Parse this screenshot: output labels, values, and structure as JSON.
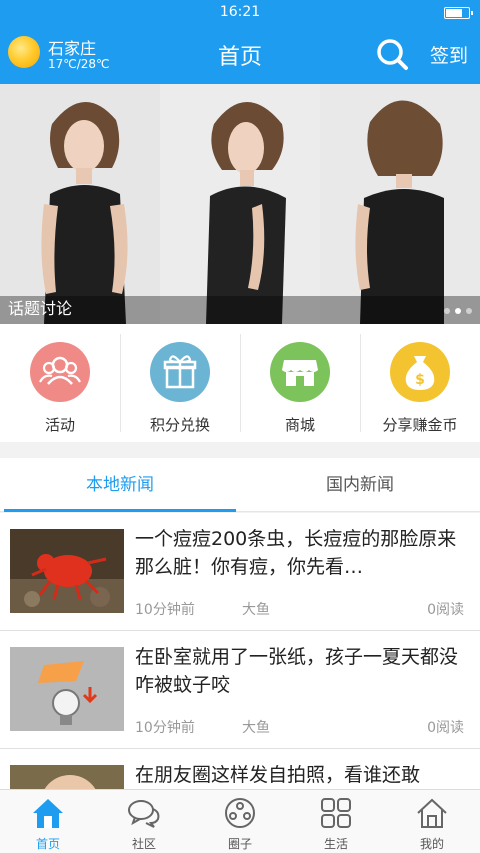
{
  "status_bar": {
    "time": "16:21",
    "battery_level": 0.8
  },
  "header": {
    "city": "石家庄",
    "temperature": "17℃/28℃",
    "title": "首页",
    "signin_label": "签到",
    "weather_icon": "sun-icon",
    "search_icon": "search-icon"
  },
  "banner": {
    "caption": "话题讨论",
    "slide_count": 3,
    "active_slide": 2
  },
  "quick_entries": [
    {
      "label": "活动",
      "icon": "people-icon",
      "color": "#f08a86"
    },
    {
      "label": "积分兑换",
      "icon": "gift-icon",
      "color": "#6cb4d4"
    },
    {
      "label": "商城",
      "icon": "store-icon",
      "color": "#7cc35c"
    },
    {
      "label": "分享赚金币",
      "icon": "money-bag-icon",
      "color": "#f4c430"
    }
  ],
  "tabs": [
    {
      "label": "本地新闻",
      "active": true
    },
    {
      "label": "国内新闻",
      "active": false
    }
  ],
  "news": [
    {
      "title": "一个痘痘200条虫，长痘痘的那脸原来那么脏！你有痘，你先看…",
      "time": "10分钟前",
      "source": "大鱼",
      "reads": "0阅读"
    },
    {
      "title": "在卧室就用了一张纸，孩子一夏天都没咋被蚊子咬",
      "time": "10分钟前",
      "source": "大鱼",
      "reads": "0阅读"
    },
    {
      "title": "在朋友圈这样发自拍照，看谁还敢",
      "time": "",
      "source": "",
      "reads": ""
    }
  ],
  "bottom_nav": [
    {
      "label": "首页",
      "icon": "home-icon",
      "active": true
    },
    {
      "label": "社区",
      "icon": "chat-bubbles-icon",
      "active": false
    },
    {
      "label": "圈子",
      "icon": "circle-icon",
      "active": false
    },
    {
      "label": "生活",
      "icon": "grid-icon",
      "active": false
    },
    {
      "label": "我的",
      "icon": "house-outline-icon",
      "active": false
    }
  ],
  "colors": {
    "primary": "#1e9df0",
    "text": "#222222",
    "muted": "#999999"
  }
}
